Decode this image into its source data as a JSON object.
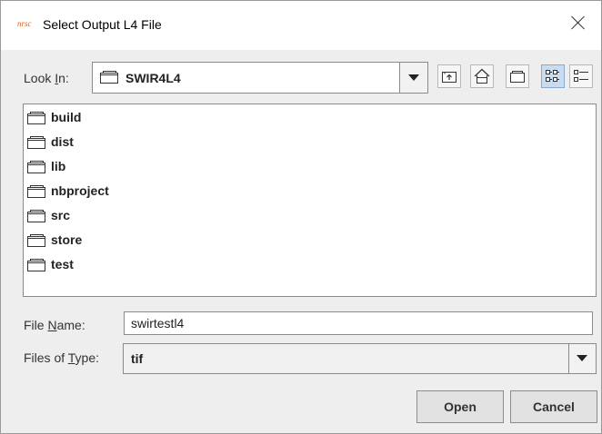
{
  "window": {
    "app_logo_text": "nrsc",
    "title": "Select Output L4 File"
  },
  "look_in": {
    "label_prefix": "Look ",
    "label_mnemonic": "I",
    "label_suffix": "n:",
    "selected": "SWIR4L4"
  },
  "toolbar": {
    "icons": [
      "up-one-level-icon",
      "home-icon",
      "new-folder-icon",
      "list-view-icon",
      "details-view-icon"
    ],
    "active_view": "list-view"
  },
  "files": [
    {
      "name": "build",
      "icon": "folder-icon"
    },
    {
      "name": "dist",
      "icon": "folder-icon"
    },
    {
      "name": "lib",
      "icon": "folder-icon"
    },
    {
      "name": "nbproject",
      "icon": "folder-icon"
    },
    {
      "name": "src",
      "icon": "folder-icon"
    },
    {
      "name": "store",
      "icon": "folder-icon"
    },
    {
      "name": "test",
      "icon": "folder-icon"
    }
  ],
  "file_name": {
    "label_prefix": "File ",
    "label_mnemonic": "N",
    "label_suffix": "ame:",
    "value": "swirtestl4"
  },
  "files_of_type": {
    "label_prefix": "Files of ",
    "label_mnemonic": "T",
    "label_suffix": "ype:",
    "selected": "tif"
  },
  "buttons": {
    "open": "Open",
    "cancel": "Cancel"
  }
}
